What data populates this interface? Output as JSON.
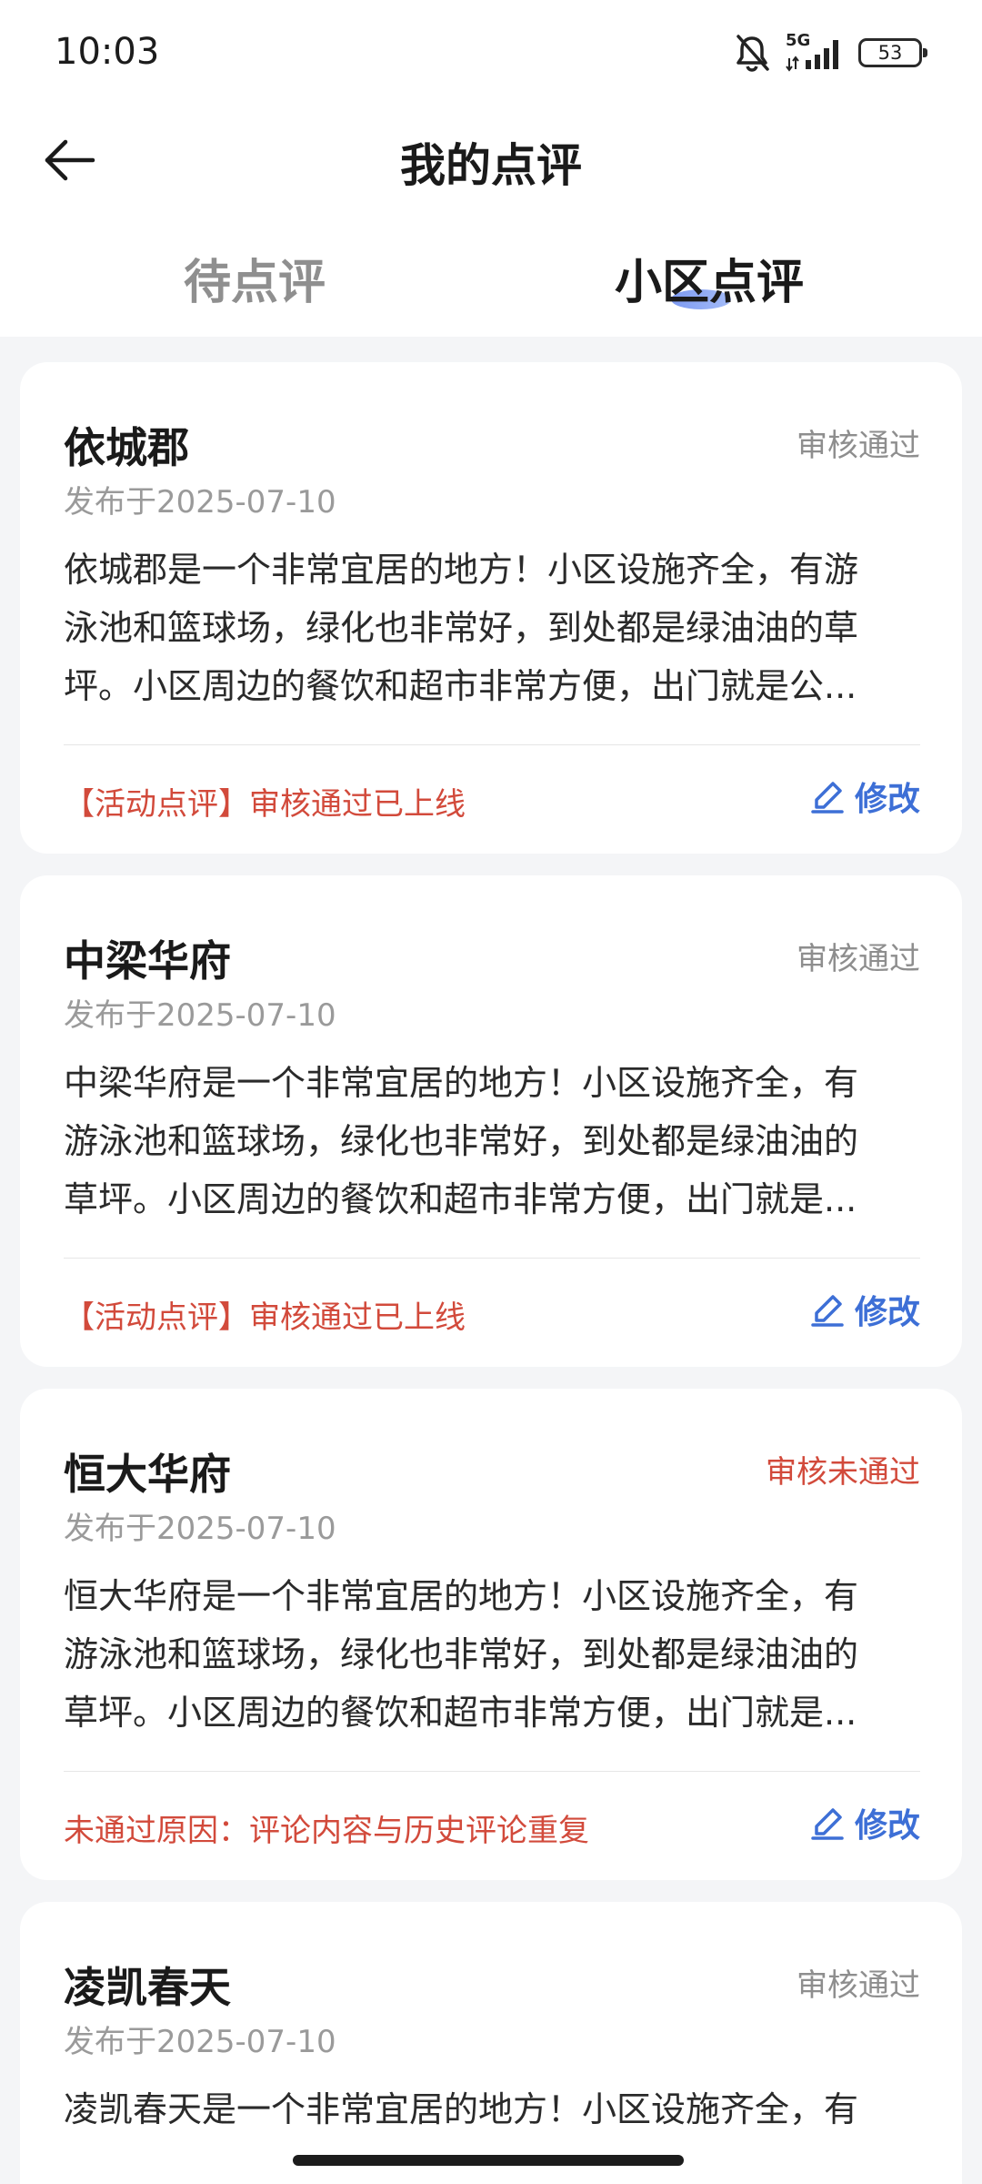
{
  "status_bar": {
    "time": "10:03",
    "network": "5G",
    "battery": "53"
  },
  "header": {
    "title": "我的点评"
  },
  "tabs": [
    {
      "label": "待点评",
      "active": false
    },
    {
      "label": "小区点评",
      "active": true
    }
  ],
  "cards": [
    {
      "name": "依城郡",
      "status": "审核通过",
      "date": "发布于2025-07-10",
      "content": "依城郡是一个非常宜居的地方！小区设施齐全，有游\n泳池和篮球场，绿化也非常好，到处都是绿油油的草\n坪。小区周边的餐饮和超市非常方便，出门就是公...",
      "note": "【活动点评】审核通过已上线",
      "edit_label": "修改"
    },
    {
      "name": "中梁华府",
      "status": "审核通过",
      "date": "发布于2025-07-10",
      "content": "中梁华府是一个非常宜居的地方！小区设施齐全，有\n游泳池和篮球场，绿化也非常好，到处都是绿油油的\n草坪。小区周边的餐饮和超市非常方便，出门就是...",
      "note": "【活动点评】审核通过已上线",
      "edit_label": "修改"
    },
    {
      "name": "恒大华府",
      "status": "审核未通过",
      "date": "发布于2025-07-10",
      "content": "恒大华府是一个非常宜居的地方！小区设施齐全，有\n游泳池和篮球场，绿化也非常好，到处都是绿油油的\n草坪。小区周边的餐饮和超市非常方便，出门就是...",
      "note": "未通过原因：评论内容与历史评论重复",
      "edit_label": "修改"
    },
    {
      "name": "凌凯春天",
      "status": "审核通过",
      "date": "发布于2025-07-10",
      "content": "凌凯春天是一个非常宜居的地方！小区设施齐全，有"
    }
  ],
  "colors": {
    "accent": "#3d6fd6",
    "alert": "#d24a3b",
    "background": "#f4f5f7"
  },
  "icons": {
    "back": "arrow-left-icon",
    "edit": "pencil-icon",
    "mute": "bell-off-icon"
  }
}
